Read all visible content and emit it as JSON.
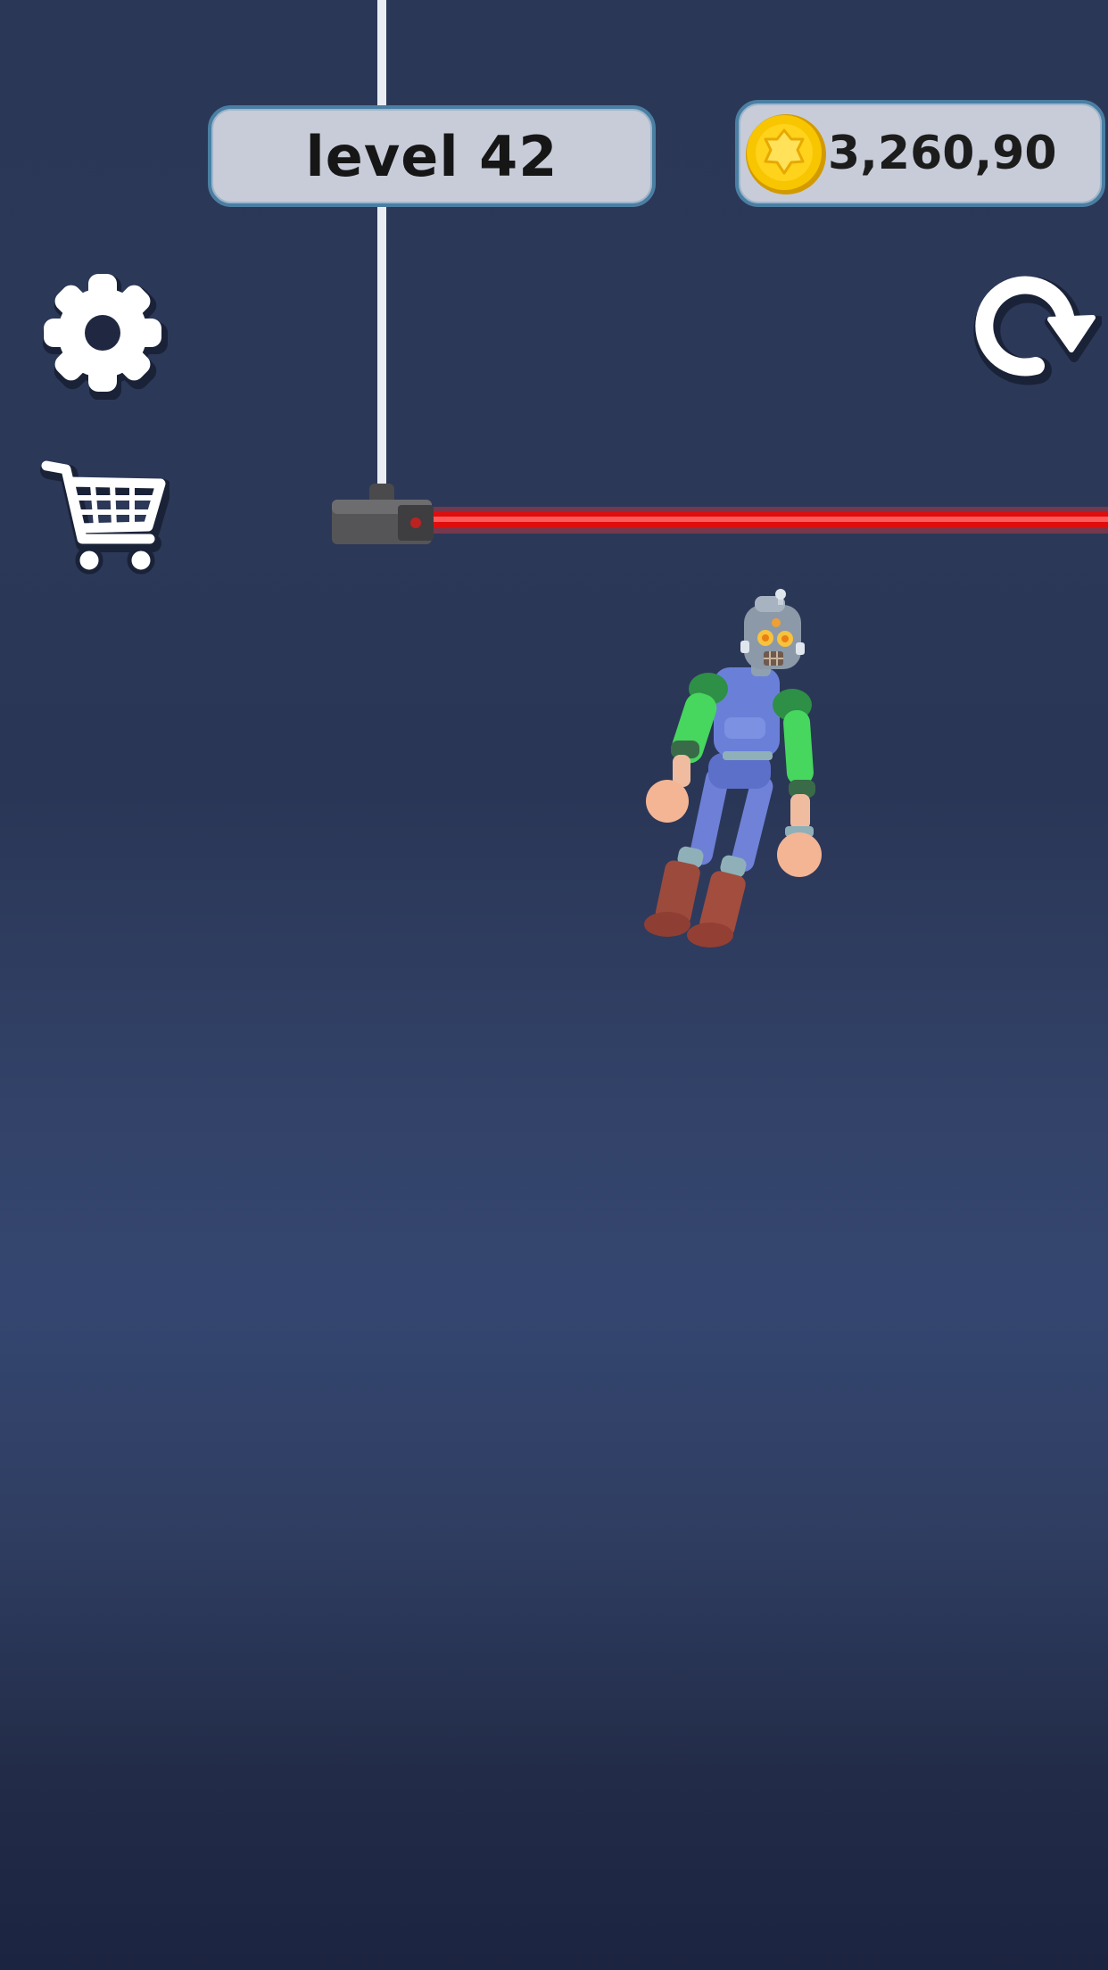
{
  "hud": {
    "level_label": "level 42",
    "coins": "3,260,90"
  },
  "icons": {
    "settings": "gear-icon",
    "shop": "shopping-cart-icon",
    "restart": "restart-arrow-icon",
    "currency": "gold-coin-icon"
  },
  "colors": {
    "hud_pill": "#c7ccd8",
    "hud_border": "#4a7fa3",
    "laser": "#e00d0d",
    "rope": "#e9edf3",
    "coin": "#f5c400"
  }
}
